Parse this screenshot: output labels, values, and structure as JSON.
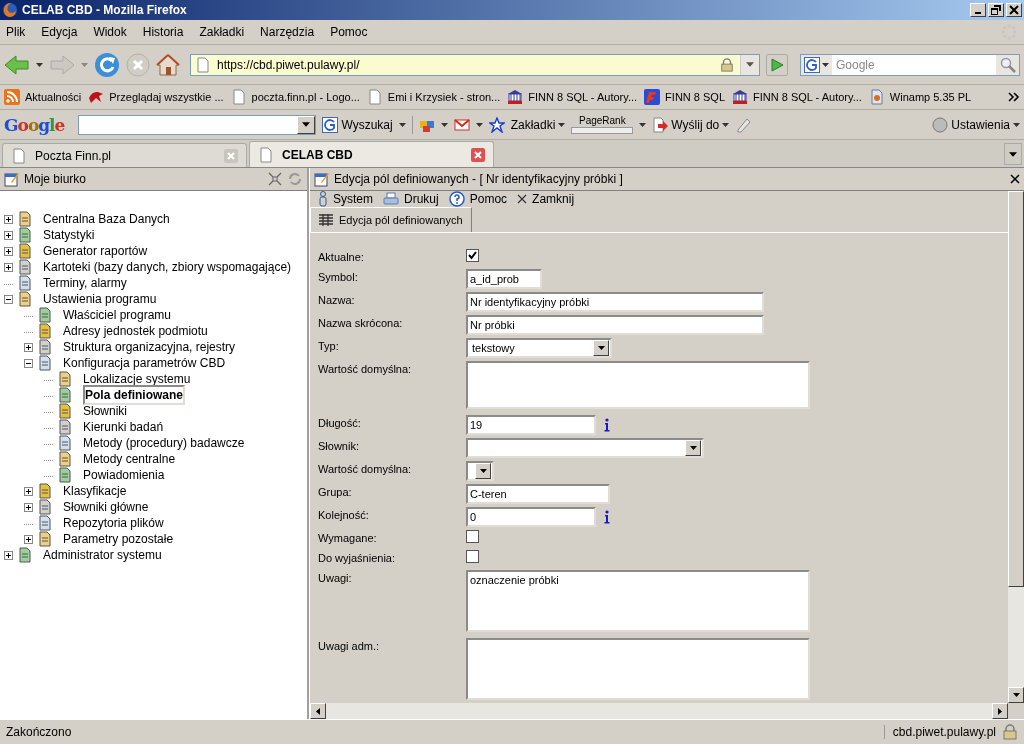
{
  "window": {
    "title": "CELAB CBD - Mozilla Firefox"
  },
  "menu": [
    "Plik",
    "Edycja",
    "Widok",
    "Historia",
    "Zakładki",
    "Narzędzia",
    "Pomoc"
  ],
  "address_bar": {
    "url": "https://cbd.piwet.pulawy.pl/"
  },
  "search": {
    "placeholder": "Google"
  },
  "bookmarks": [
    {
      "label": "Aktualności",
      "kind": "feed"
    },
    {
      "label": "Przeglądaj wszystkie ...",
      "kind": "bird"
    },
    {
      "label": "poczta.finn.pl - Logo...",
      "kind": "page"
    },
    {
      "label": "Emi i Krzysiek - stron...",
      "kind": "page"
    },
    {
      "label": "FINN 8 SQL - Autory...",
      "kind": "building"
    },
    {
      "label": "FINN 8 SQL",
      "kind": "finn"
    },
    {
      "label": "FINN 8 SQL - Autory...",
      "kind": "building"
    },
    {
      "label": "Winamp 5.35 PL",
      "kind": "winamp"
    }
  ],
  "google_toolbar": {
    "logo": "Google",
    "search_button": "Wyszukaj",
    "bookmarks_button": "Zakładki",
    "pagerank": "PageRank",
    "send_button": "Wyślij do",
    "settings_button": "Ustawienia"
  },
  "tabs": [
    {
      "label": "Poczta Finn.pl",
      "selected": false
    },
    {
      "label": "CELAB CBD",
      "selected": true
    }
  ],
  "sidebar": {
    "title": "Moje biurko",
    "tree": [
      {
        "label": "Centralna Baza Danych",
        "expanded": false,
        "selected": false
      },
      {
        "label": "Statystyki",
        "expanded": false,
        "selected": false
      },
      {
        "label": "Generator raportów",
        "expanded": false,
        "selected": false
      },
      {
        "label": "Kartoteki (bazy danych, zbiory wspomagające)",
        "expanded": false,
        "selected": false
      },
      {
        "label": "Terminy, alarmy",
        "selected": false
      },
      {
        "label": "Ustawienia programu",
        "expanded": true,
        "selected": false,
        "children": [
          {
            "label": "Właściciel programu",
            "selected": false
          },
          {
            "label": "Adresy jednostek podmiotu",
            "selected": false
          },
          {
            "label": "Struktura organizacyjna, rejestry",
            "expanded": false,
            "selected": false
          },
          {
            "label": "Konfiguracja parametrów CBD",
            "expanded": true,
            "selected": false,
            "children": [
              {
                "label": "Lokalizacje systemu",
                "selected": false
              },
              {
                "label": "Pola definiowane",
                "selected": true
              },
              {
                "label": "Słowniki",
                "selected": false
              },
              {
                "label": "Kierunki badań",
                "selected": false
              },
              {
                "label": "Metody (procedury) badawcze",
                "selected": false
              },
              {
                "label": "Metody centralne",
                "selected": false
              },
              {
                "label": "Powiadomienia",
                "selected": false
              }
            ]
          },
          {
            "label": "Klasyfikacje",
            "expanded": false,
            "selected": false
          },
          {
            "label": "Słowniki główne",
            "expanded": false,
            "selected": false
          },
          {
            "label": "Repozytoria plików",
            "selected": false
          },
          {
            "label": "Parametry pozostałe",
            "expanded": false,
            "selected": false
          }
        ]
      },
      {
        "label": "Administrator systemu",
        "expanded": false,
        "selected": false
      }
    ]
  },
  "panel": {
    "title": "Edycja pól definiowanych - [ Nr identyfikacyjny próbki ]",
    "toolbar": [
      {
        "label": "System",
        "kind": "user"
      },
      {
        "label": "Drukuj",
        "kind": "print"
      },
      {
        "label": "Pomoc",
        "kind": "help"
      },
      {
        "label": "Zamknij",
        "kind": "close"
      }
    ],
    "tab": "Edycja pól definiowanych",
    "fields": [
      {
        "label": "Aktualne:",
        "kind": "checkbox",
        "checked": true
      },
      {
        "label": "Symbol:",
        "kind": "code",
        "value": "a_id_prob"
      },
      {
        "label": "Nazwa:",
        "kind": "text",
        "value": "Nr identyfikacyjny próbki"
      },
      {
        "label": "Nazwa skrócona:",
        "kind": "text",
        "value": "Nr próbki"
      },
      {
        "label": "Typ:",
        "kind": "select",
        "value": "tekstowy"
      },
      {
        "label": "Wartość domyślna:",
        "kind": "textarea"
      },
      {
        "label": "Długość:",
        "kind": "number",
        "value": "19",
        "info": true
      },
      {
        "label": "Słownik:",
        "kind": "wide-select"
      },
      {
        "label": "Wartość domyślna:",
        "kind": "mini-select"
      },
      {
        "label": "Grupa:",
        "kind": "group",
        "value": "C-teren"
      },
      {
        "label": "Kolejność:",
        "kind": "number",
        "value": "0",
        "info": true
      },
      {
        "label": "Wymagane:",
        "kind": "checkbox",
        "checked": false
      },
      {
        "label": "Do wyjaśnienia:",
        "kind": "checkbox",
        "checked": false
      },
      {
        "label": "Uwagi:",
        "kind": "notes",
        "value": "oznaczenie próbki"
      },
      {
        "label": "Uwagi adm.:",
        "kind": "notes"
      }
    ]
  },
  "status_bar": {
    "text": "Zakończono",
    "host": "cbd.piwet.pulawy.pl"
  }
}
